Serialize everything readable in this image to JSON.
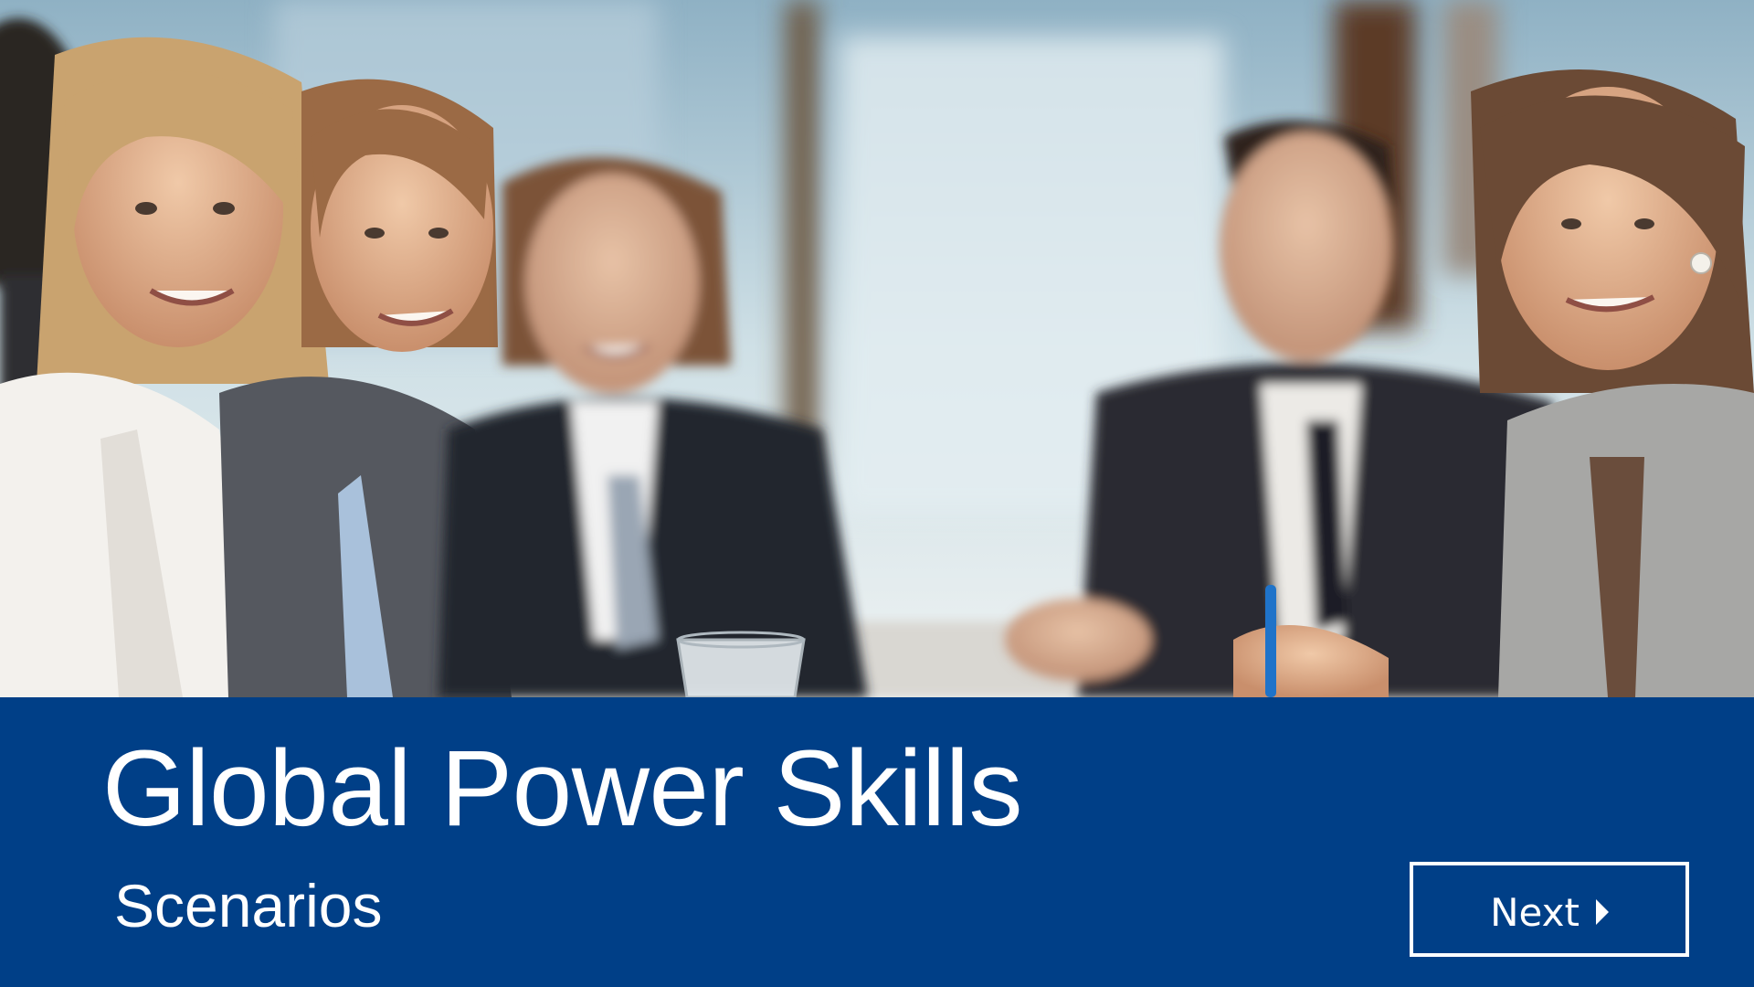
{
  "slide": {
    "title": "Global Power Skills",
    "subtitle": "Scenarios"
  },
  "navigation": {
    "next_label": "Next",
    "next_icon": "caret-right-icon"
  },
  "colors": {
    "banner": "#003f87",
    "text": "#ffffff"
  }
}
